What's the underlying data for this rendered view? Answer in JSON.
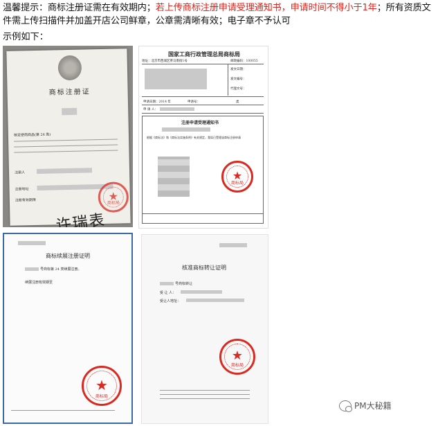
{
  "notice": {
    "prefix": "温馨提示：商标注册证需在有效期内；",
    "highlight": "若上传商标注册申请受理通知书，申请时间不得小于1年",
    "suffix": "；所有资质文件需上传扫描件并加盖开店公司鲜章，公章需清晰有效；电子章不予认可"
  },
  "example_label": "示例如下：",
  "cert1": {
    "title": "商标注册证",
    "fields": [
      "注册人",
      "注册地址",
      "注册有效期限",
      "核定使用商品(第 24 类)"
    ],
    "signature": "许瑞表",
    "seal_label": "商标局"
  },
  "cert2": {
    "header": "国家工商行政管理总局商标局",
    "address": "地址：北京市西城区茶马南街1号",
    "zip": "邮政编码：100055",
    "rows": [
      "申请日期：2014 年",
      "申请号：",
      "类",
      "申 请 人："
    ],
    "right_fields": [
      "发文日期：",
      "发文编号：",
      "代理文号："
    ],
    "notice_title": "注册申请受理通知书",
    "body_text": "根据《商标法》和《商标法实施条例》有关规定，我局已受理该商标注册申请",
    "seal_label": "商标局"
  },
  "cert3": {
    "title": "商标续展注册证明",
    "line1": "号商标第 24 类续展注册。",
    "line2": "续展注册有效期至",
    "seal_label": "商标局"
  },
  "cert4": {
    "title": "核准商标转让证明",
    "line1": "号商标转让",
    "line2": "受 让 人：",
    "line3": "受让人地址：",
    "seal_label": "商标局"
  },
  "watermark": {
    "text": "PM大秘籍"
  },
  "colors": {
    "highlight": "#e0231a",
    "seal": "#d92a22",
    "frame": "#3a6aa3"
  }
}
